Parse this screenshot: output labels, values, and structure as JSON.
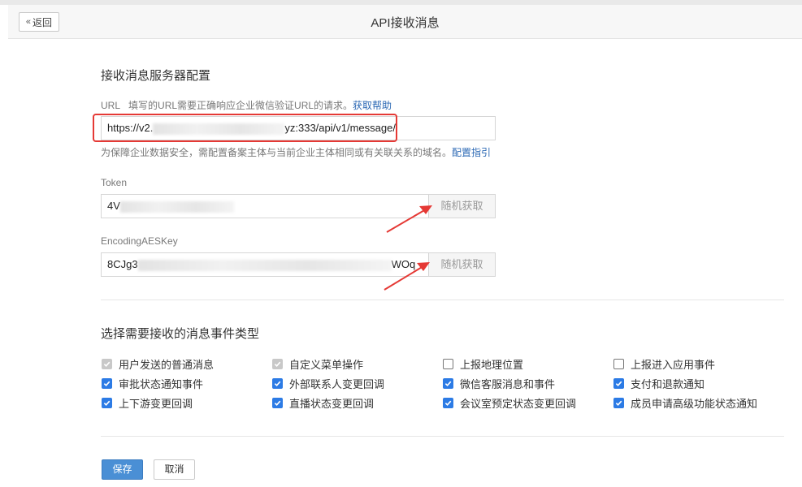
{
  "header": {
    "back_label": "返回",
    "title": "API接收消息"
  },
  "server_config": {
    "section_title": "接收消息服务器配置",
    "url": {
      "label": "URL",
      "description": "填写的URL需要正确响应企业微信验证URL的请求。",
      "help_link": "获取帮助",
      "value_start": "https://v2.",
      "value_end": "yz:333/api/v1/message/",
      "hint": "为保障企业数据安全，需配置备案主体与当前企业主体相同或有关联关系的域名。",
      "hint_link": "配置指引"
    },
    "token": {
      "label": "Token",
      "value_start": "4V",
      "button": "随机获取"
    },
    "aes_key": {
      "label": "EncodingAESKey",
      "value_start": "8CJg3",
      "value_end": "WOq",
      "button": "随机获取"
    }
  },
  "events": {
    "section_title": "选择需要接收的消息事件类型",
    "options": [
      {
        "label": "用户发送的普通消息",
        "state": "disabled"
      },
      {
        "label": "自定义菜单操作",
        "state": "disabled"
      },
      {
        "label": "上报地理位置",
        "state": "unchecked"
      },
      {
        "label": "上报进入应用事件",
        "state": "unchecked"
      },
      {
        "label": "审批状态通知事件",
        "state": "checked"
      },
      {
        "label": "外部联系人变更回调",
        "state": "checked"
      },
      {
        "label": "微信客服消息和事件",
        "state": "checked"
      },
      {
        "label": "支付和退款通知",
        "state": "checked"
      },
      {
        "label": "上下游变更回调",
        "state": "checked"
      },
      {
        "label": "直播状态变更回调",
        "state": "checked"
      },
      {
        "label": "会议室预定状态变更回调",
        "state": "checked"
      },
      {
        "label": "成员申请高级功能状态通知",
        "state": "checked"
      }
    ]
  },
  "actions": {
    "save_label": "保存",
    "cancel_label": "取消"
  },
  "colors": {
    "accent": "#2c7be5",
    "link": "#2b68b4",
    "annotation_red": "#e53935"
  }
}
